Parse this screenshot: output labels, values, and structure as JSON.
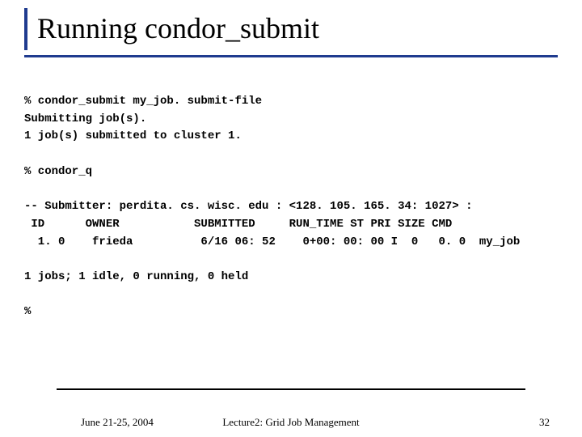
{
  "title": "Running condor_submit",
  "terminal": "% condor_submit my_job. submit-file\nSubmitting job(s).\n1 job(s) submitted to cluster 1.\n\n% condor_q\n\n-- Submitter: perdita. cs. wisc. edu : <128. 105. 165. 34: 1027> :\n ID      OWNER           SUBMITTED     RUN_TIME ST PRI SIZE CMD\n  1. 0    frieda          6/16 06: 52    0+00: 00: 00 I  0   0. 0  my_job\n\n1 jobs; 1 idle, 0 running, 0 held\n\n%",
  "footer": {
    "date": "June 21-25, 2004",
    "center": "Lecture2: Grid Job Management",
    "page": "32"
  }
}
